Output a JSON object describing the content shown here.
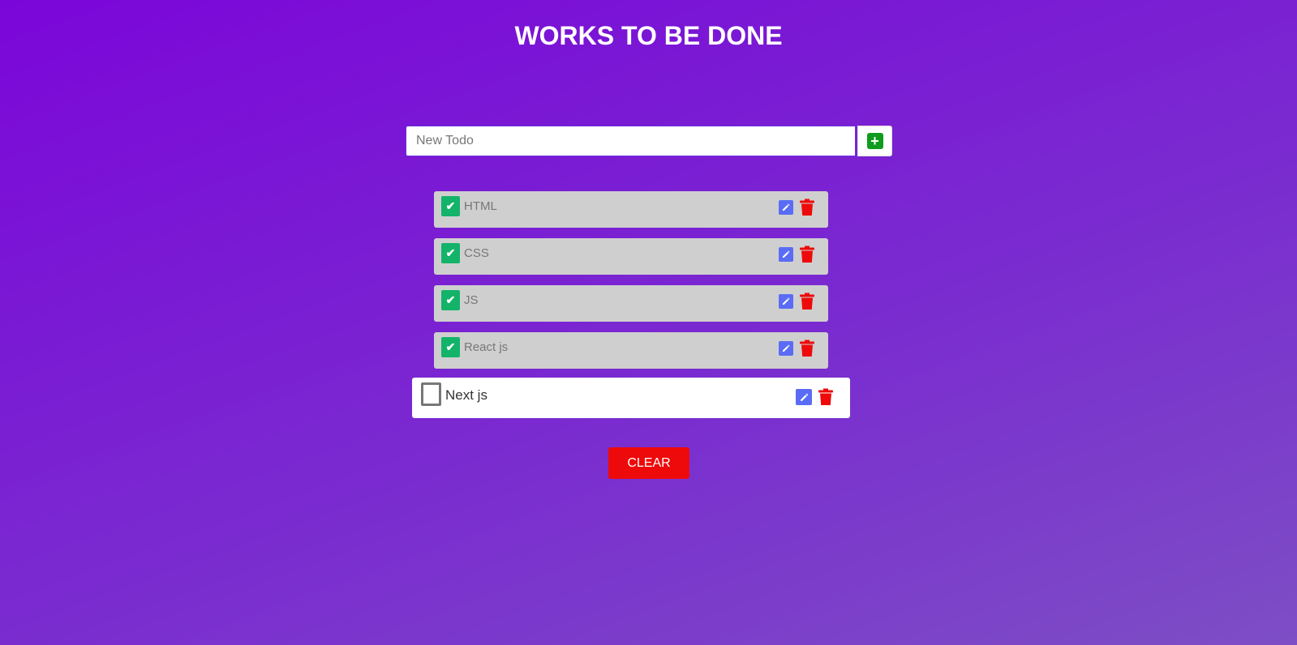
{
  "header": {
    "title": "WORKS TO BE DONE"
  },
  "input": {
    "placeholder": "New Todo",
    "value": ""
  },
  "add_button": {
    "icon": "plus-square-icon",
    "color": "#0e9b1e"
  },
  "todos": [
    {
      "label": "HTML",
      "done": true
    },
    {
      "label": "CSS",
      "done": true
    },
    {
      "label": "JS",
      "done": true
    },
    {
      "label": "React js",
      "done": true
    },
    {
      "label": "Next js",
      "done": false
    }
  ],
  "icons": {
    "check": "✔",
    "plus": "+"
  },
  "colors": {
    "check_green": "#13b36a",
    "edit_blue": "#5a6cf5",
    "delete_red": "#ee0a0a"
  },
  "clear_button": {
    "label": "CLEAR"
  }
}
